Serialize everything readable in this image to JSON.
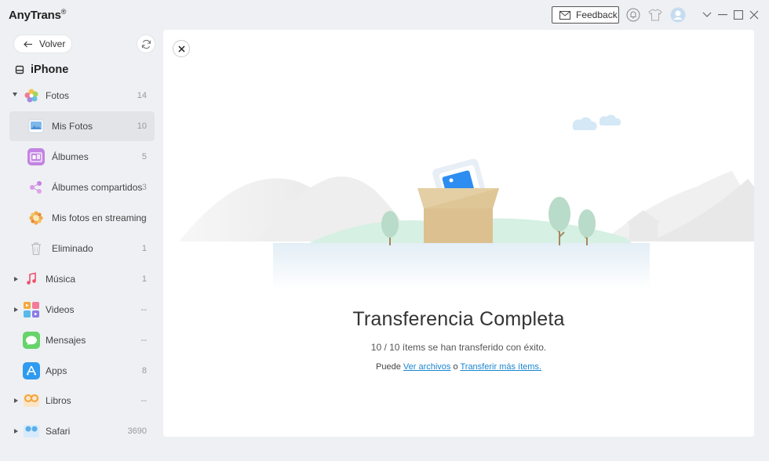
{
  "app": {
    "name": "AnyTrans",
    "reg": "®",
    "feedback_label": "Feedback"
  },
  "sidebar": {
    "back_label": "Volver",
    "device_name": "iPhone",
    "items": [
      {
        "label": "Fotos",
        "count": "14",
        "icon": "photos-icon",
        "expanded": true
      },
      {
        "label": "Mis Fotos",
        "count": "10",
        "icon": "my-photos-icon",
        "selected": true
      },
      {
        "label": "Álbumes",
        "count": "5",
        "icon": "albums-icon"
      },
      {
        "label": "Álbumes compartidos",
        "count": "3",
        "icon": "shared-albums-icon"
      },
      {
        "label": "Mis fotos en streaming",
        "count": "--",
        "icon": "photo-stream-icon"
      },
      {
        "label": "Eliminado",
        "count": "1",
        "icon": "trash-icon"
      },
      {
        "label": "Música",
        "count": "1",
        "icon": "music-icon"
      },
      {
        "label": "Videos",
        "count": "--",
        "icon": "videos-icon"
      },
      {
        "label": "Mensajes",
        "count": "--",
        "icon": "messages-icon"
      },
      {
        "label": "Apps",
        "count": "8",
        "icon": "apps-icon"
      },
      {
        "label": "Libros",
        "count": "--",
        "icon": "books-icon"
      },
      {
        "label": "Safari",
        "count": "3690",
        "icon": "safari-icon"
      }
    ]
  },
  "main": {
    "title": "Transferencia Completa",
    "subtitle": "10 / 10 ítems se han transferido con éxito.",
    "actions_prefix": "Puede",
    "link_view": "Ver archivos",
    "connector": "o",
    "link_more": "Transferir más ítems."
  },
  "colors": {
    "link": "#1a86d0",
    "selected_bg": "#e2e4e8",
    "sidebar_bg": "#eef0f3"
  }
}
